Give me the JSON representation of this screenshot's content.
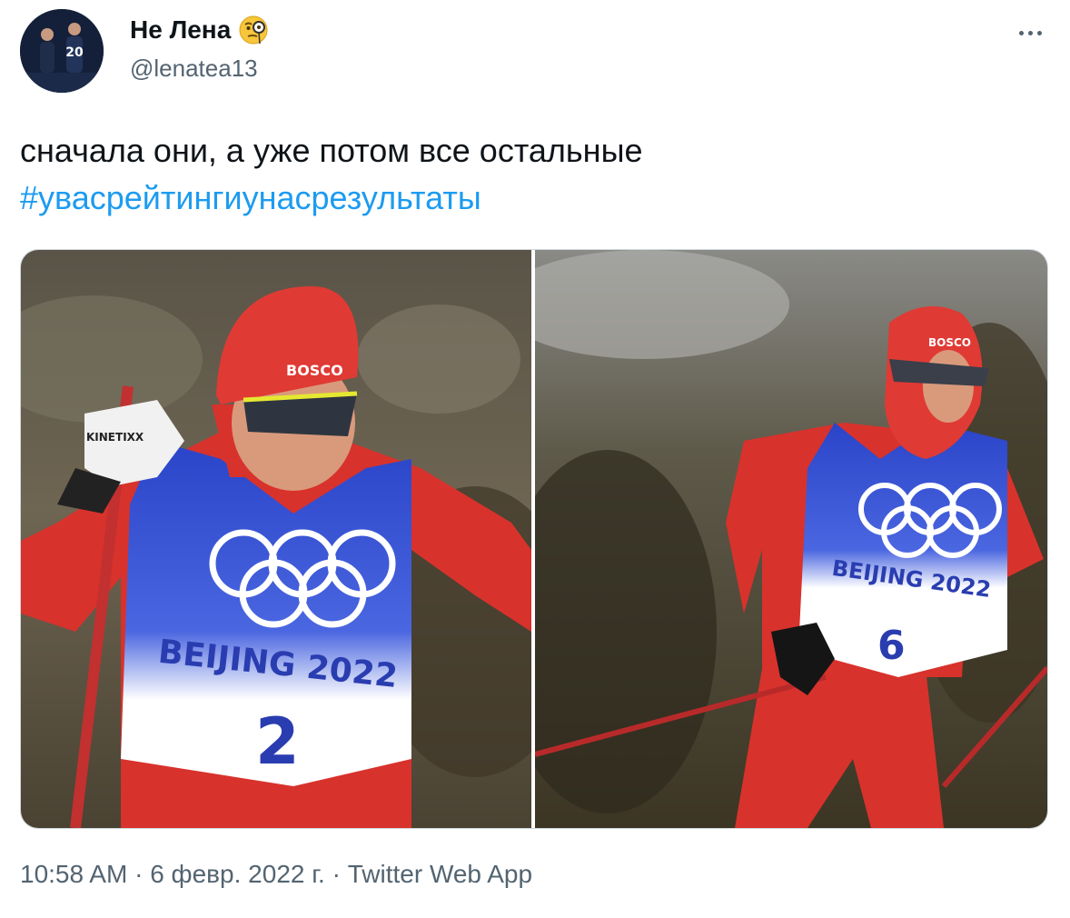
{
  "author": {
    "display_name": "Не Лена",
    "handle": "@lenatea13",
    "emoji_icon": "face-with-monocle-icon"
  },
  "tweet": {
    "text": "сначала они, а уже потом все остальные",
    "hashtag": "#увасрейтингиунасрезультаты"
  },
  "media": {
    "photos": [
      {
        "bib_text": "BEIJING 2022",
        "bib_number": "2",
        "hat_brand": "BOSCO",
        "glove_brand": "KINETIXX"
      },
      {
        "bib_text": "BEIJING 2022",
        "bib_number": "6",
        "hat_brand": "BOSCO"
      }
    ]
  },
  "meta": {
    "time": "10:58 AM",
    "separator": "·",
    "date": "6 февр. 2022 г.",
    "source": "Twitter Web App"
  },
  "icons": {
    "more": "more-horizontal-icon"
  },
  "colors": {
    "link": "#1d9bf0",
    "secondary_text": "#536471",
    "primary_text": "#0f1419"
  }
}
